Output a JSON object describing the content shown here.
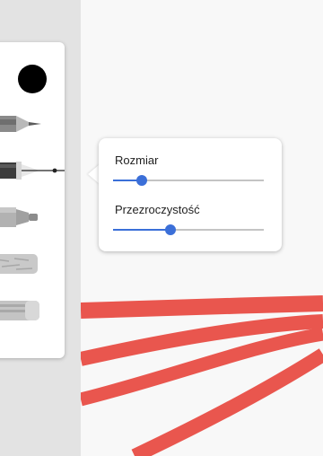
{
  "colors": {
    "accent": "#3b6fd8",
    "selected_color": "#000000",
    "stroke_color": "#e8453c"
  },
  "toolbar": {
    "color_swatch": {
      "name": "color-swatch",
      "value": "#000000"
    },
    "tools": [
      {
        "name": "pencil",
        "icon": "pencil-icon",
        "selected": false
      },
      {
        "name": "fountain-pen",
        "icon": "fountain-pen-icon",
        "selected": true
      },
      {
        "name": "marker",
        "icon": "marker-icon",
        "selected": false
      },
      {
        "name": "chalk",
        "icon": "chalk-icon",
        "selected": false
      },
      {
        "name": "eraser",
        "icon": "eraser-icon",
        "selected": false
      }
    ]
  },
  "settings_popup": {
    "size_label": "Rozmiar",
    "size_value": 0.19,
    "opacity_label": "Przezroczystość",
    "opacity_value": 0.38
  }
}
